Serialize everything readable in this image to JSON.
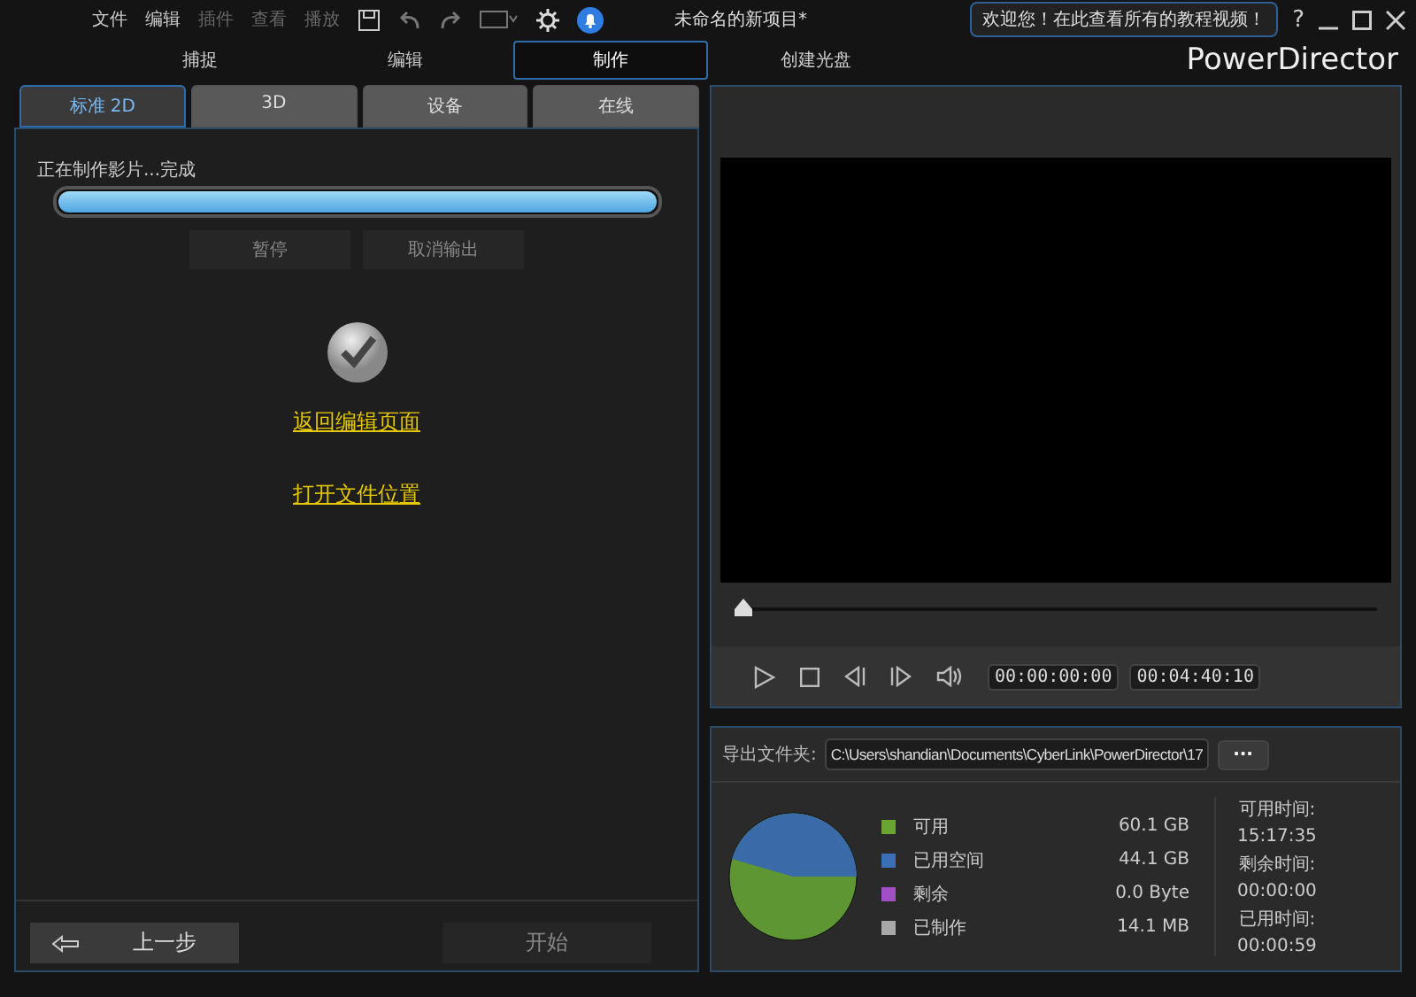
{
  "menu": [
    {
      "label": "文件",
      "disabled": false
    },
    {
      "label": "编辑",
      "disabled": false
    },
    {
      "label": "插件",
      "disabled": true
    },
    {
      "label": "查看",
      "disabled": true
    },
    {
      "label": "播放",
      "disabled": true
    }
  ],
  "window": {
    "title": "未命名的新项目*",
    "tip": "欢迎您！在此查看所有的教程视频！",
    "help": "?",
    "brand": "PowerDirector"
  },
  "modes": [
    {
      "label": "捕捉",
      "selected": false
    },
    {
      "label": "编辑",
      "selected": false
    },
    {
      "label": "制作",
      "selected": true
    },
    {
      "label": "创建光盘",
      "selected": false
    }
  ],
  "tabs": [
    {
      "label": "标准 2D",
      "selected": true
    },
    {
      "label": "3D",
      "selected": false
    },
    {
      "label": "设备",
      "selected": false
    },
    {
      "label": "在线",
      "selected": false
    }
  ],
  "progress": {
    "status": "正在制作影片...完成",
    "level": 1.0
  },
  "actions": [
    "暂停",
    "取消输出"
  ],
  "links": [
    "返回编辑页面",
    "打开文件位置"
  ],
  "nav": {
    "back": "上一步",
    "start": "开始"
  },
  "player": {
    "level": 0,
    "current": "00:00:00:00",
    "duration": "00:04:40:10"
  },
  "export": {
    "label": "导出文件夹:",
    "path": "C:\\Users\\shandian\\Documents\\CyberLink\\PowerDirector\\17",
    "browse": "···"
  },
  "disk": {
    "legend": [
      {
        "label": "可用",
        "value": "60.1  GB",
        "color": "#6aa431"
      },
      {
        "label": "已用空间",
        "value": "44.1  GB",
        "color": "#3a6eb5"
      },
      {
        "label": "剩余",
        "value": "0.0  Byte",
        "color": "#a04fc4"
      },
      {
        "label": "已制作",
        "value": "14.1  MB",
        "color": "#a8a8a8"
      }
    ],
    "times": [
      {
        "label": "可用时间:",
        "value": "15:17:35"
      },
      {
        "label": "剩余时间:",
        "value": "00:00:00"
      },
      {
        "label": "已用时间:",
        "value": "00:00:59"
      }
    ]
  }
}
